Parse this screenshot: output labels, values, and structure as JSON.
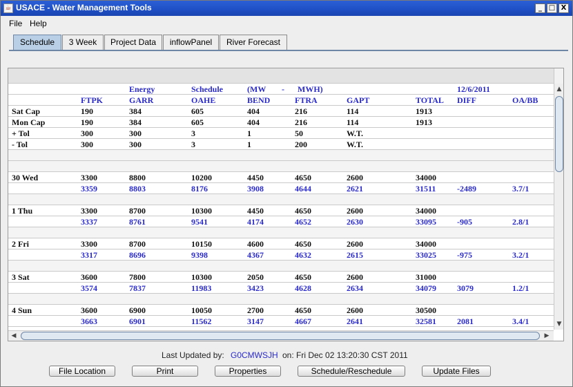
{
  "window": {
    "title": "USACE - Water Management Tools",
    "controls": [
      "_",
      "□",
      "X"
    ]
  },
  "menu": [
    "File",
    "Help"
  ],
  "tabs": [
    "Schedule",
    "3 Week",
    "Project Data",
    "inflowPanel",
    "River Forecast"
  ],
  "active_tab": "Schedule",
  "table": {
    "header_top": [
      "Energy",
      "Schedule",
      "(MW",
      "-",
      "MWH)",
      "12/6/2011"
    ],
    "header_cols": [
      "FTPK",
      "GARR",
      "OAHE",
      "BEND",
      "FTRA",
      "GAPT",
      "TOTAL",
      "DIFF",
      "OA/BB"
    ],
    "rows": [
      {
        "label": "Sat Cap",
        "cells": [
          "190",
          "384",
          "605",
          "404",
          "216",
          "114",
          "1913",
          "",
          ""
        ],
        "style": "black"
      },
      {
        "label": "Mon Cap",
        "cells": [
          "190",
          "384",
          "605",
          "404",
          "216",
          "114",
          "1913",
          "",
          ""
        ],
        "style": "black"
      },
      {
        "label": "+ Tol",
        "cells": [
          "300",
          "300",
          "3",
          "1",
          "50",
          "W.T.",
          "",
          "",
          ""
        ],
        "style": "black"
      },
      {
        "label": "- Tol",
        "cells": [
          "300",
          "300",
          "3",
          "1",
          "200",
          "W.T.",
          "",
          "",
          ""
        ],
        "style": "black"
      },
      {
        "label": "",
        "cells": [
          "",
          "",
          "",
          "",
          "",
          "",
          "",
          "",
          ""
        ],
        "style": "gray"
      },
      {
        "label": "",
        "cells": [
          "",
          "",
          "",
          "",
          "",
          "",
          "",
          "",
          ""
        ],
        "style": "gray"
      },
      {
        "label": "30 Wed",
        "cells": [
          "3300",
          "8800",
          "10200",
          "4450",
          "4650",
          "2600",
          "34000",
          "",
          ""
        ],
        "style": "black"
      },
      {
        "label": "",
        "cells": [
          "3359",
          "8803",
          "8176",
          "3908",
          "4644",
          "2621",
          "31511",
          "-2489",
          "3.7/1"
        ],
        "style": "blue"
      },
      {
        "label": "",
        "cells": [
          "",
          "",
          "",
          "",
          "",
          "",
          "",
          "",
          ""
        ],
        "style": "gray"
      },
      {
        "label": "1 Thu",
        "cells": [
          "3300",
          "8700",
          "10300",
          "4450",
          "4650",
          "2600",
          "34000",
          "",
          ""
        ],
        "style": "black"
      },
      {
        "label": "",
        "cells": [
          "3337",
          "8761",
          "9541",
          "4174",
          "4652",
          "2630",
          "33095",
          "-905",
          "2.8/1"
        ],
        "style": "blue"
      },
      {
        "label": "",
        "cells": [
          "",
          "",
          "",
          "",
          "",
          "",
          "",
          "",
          ""
        ],
        "style": "gray"
      },
      {
        "label": "2 Fri",
        "cells": [
          "3300",
          "8700",
          "10150",
          "4600",
          "4650",
          "2600",
          "34000",
          "",
          ""
        ],
        "style": "black"
      },
      {
        "label": "",
        "cells": [
          "3317",
          "8696",
          "9398",
          "4367",
          "4632",
          "2615",
          "33025",
          "-975",
          "3.2/1"
        ],
        "style": "blue"
      },
      {
        "label": "",
        "cells": [
          "",
          "",
          "",
          "",
          "",
          "",
          "",
          "",
          ""
        ],
        "style": "gray"
      },
      {
        "label": "3 Sat",
        "cells": [
          "3600",
          "7800",
          "10300",
          "2050",
          "4650",
          "2600",
          "31000",
          "",
          ""
        ],
        "style": "black"
      },
      {
        "label": "",
        "cells": [
          "3574",
          "7837",
          "11983",
          "3423",
          "4628",
          "2634",
          "34079",
          "3079",
          "1.2/1"
        ],
        "style": "blue"
      },
      {
        "label": "",
        "cells": [
          "",
          "",
          "",
          "",
          "",
          "",
          "",
          "",
          ""
        ],
        "style": "gray"
      },
      {
        "label": "4 Sun",
        "cells": [
          "3600",
          "6900",
          "10050",
          "2700",
          "4650",
          "2600",
          "30500",
          "",
          ""
        ],
        "style": "black"
      },
      {
        "label": "",
        "cells": [
          "3663",
          "6901",
          "11562",
          "3147",
          "4667",
          "2641",
          "32581",
          "2081",
          "3.4/1"
        ],
        "style": "blue"
      }
    ]
  },
  "status": {
    "last_updated_label": "Last Updated by:",
    "user": "G0CMWSJH",
    "on_text": "on: Fri Dec 02 13:20:30 CST 2011"
  },
  "buttons": [
    "File Location",
    "Print",
    "Properties",
    "Schedule/Reschedule",
    "Update Files"
  ]
}
